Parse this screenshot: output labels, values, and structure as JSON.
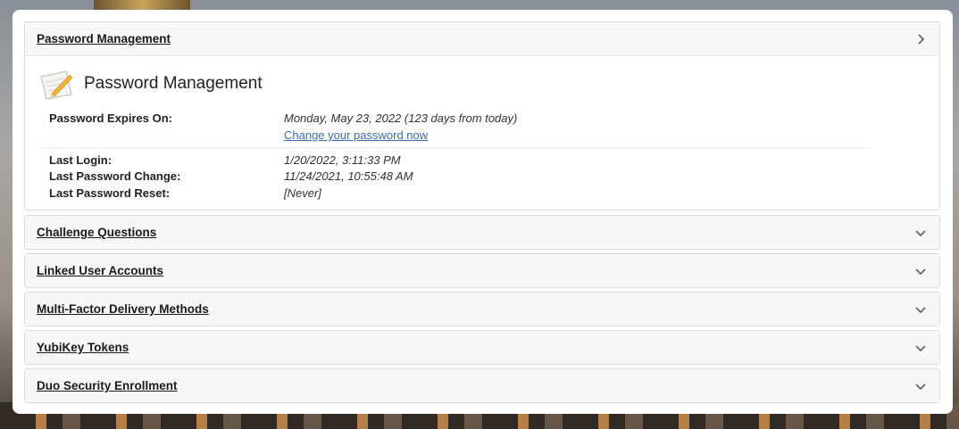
{
  "sections": [
    {
      "title": "Password Management",
      "state": "open",
      "icon": "chevron-right-icon"
    },
    {
      "title": "Challenge Questions",
      "state": "collapsed",
      "icon": "chevron-down-icon"
    },
    {
      "title": "Linked User Accounts",
      "state": "collapsed",
      "icon": "chevron-down-icon"
    },
    {
      "title": "Multi-Factor Delivery Methods",
      "state": "collapsed",
      "icon": "chevron-down-icon"
    },
    {
      "title": "YubiKey Tokens",
      "state": "collapsed",
      "icon": "chevron-down-icon"
    },
    {
      "title": "Duo Security Enrollment",
      "state": "collapsed",
      "icon": "chevron-down-icon"
    }
  ],
  "password_management": {
    "heading": "Password Management",
    "heading_icon": "notepad-pencil-icon",
    "expires_label": "Password Expires On:",
    "expires_value": "Monday, May 23, 2022 (123 days from today)",
    "change_link": "Change your password now",
    "last_login_label": "Last Login:",
    "last_login_value": "1/20/2022, 3:11:33 PM",
    "last_change_label": "Last Password Change:",
    "last_change_value": "11/24/2021, 10:55:48 AM",
    "last_reset_label": "Last Password Reset:",
    "last_reset_value": "[Never]"
  },
  "colors": {
    "link": "#3d6aa8",
    "header_bg": "#f7f7f7",
    "border": "#dcdcdc"
  }
}
